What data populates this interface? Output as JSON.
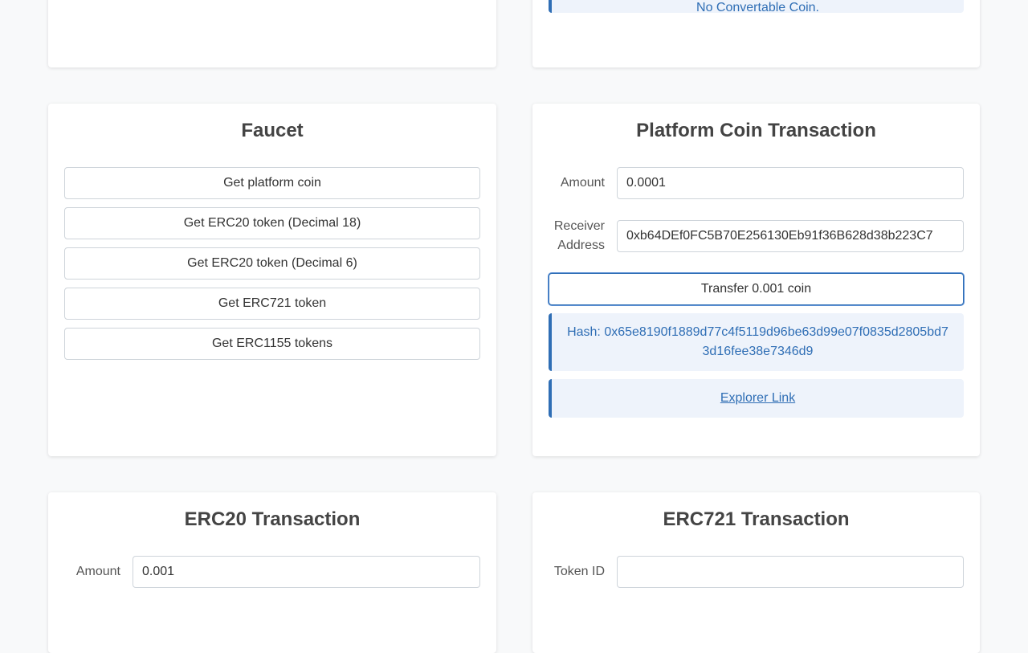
{
  "convertable": {
    "message": "No Convertable Coin."
  },
  "faucet": {
    "title": "Faucet",
    "buttons": [
      "Get platform coin",
      "Get ERC20 token (Decimal 18)",
      "Get ERC20 token (Decimal 6)",
      "Get ERC721 token",
      "Get ERC1155 tokens"
    ]
  },
  "platform_tx": {
    "title": "Platform Coin Transaction",
    "amount_label": "Amount",
    "amount_value": "0.0001",
    "receiver_label_1": "Receiver",
    "receiver_label_2": "Address",
    "receiver_value": "0xb64DEf0FC5B70E256130Eb91f36B628d38b223C7",
    "transfer_label": "Transfer 0.001 coin",
    "hash_text": "Hash: 0x65e8190f1889d77c4f5119d96be63d99e07f0835d2805bd73d16fee38e7346d9",
    "explorer_link": "Explorer Link"
  },
  "erc20_tx": {
    "title": "ERC20 Transaction",
    "amount_label": "Amount",
    "amount_value": "0.001"
  },
  "erc721_tx": {
    "title": "ERC721 Transaction",
    "token_id_label": "Token ID",
    "token_id_value": ""
  },
  "colors": {
    "accent": "#2f6eb5",
    "alert_bg": "#eef3fb",
    "page_bg": "#f8f9fa"
  }
}
